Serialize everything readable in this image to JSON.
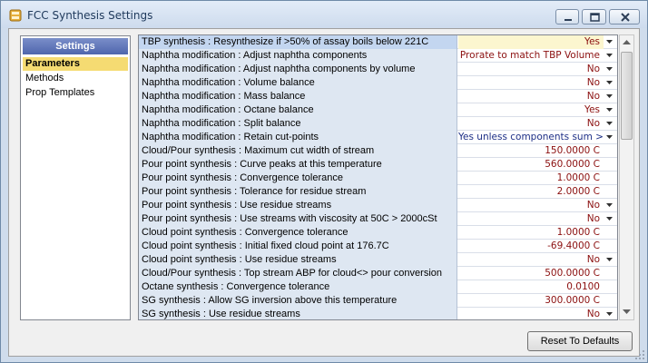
{
  "window": {
    "title": "FCC Synthesis Settings",
    "app_icon": "database-icon",
    "controls": {
      "minimize": "minimize-icon",
      "maximize": "maximize-icon",
      "close": "close-icon"
    }
  },
  "left_panel": {
    "header": "Settings",
    "items": [
      {
        "label": "Parameters",
        "selected": true
      },
      {
        "label": "Methods",
        "selected": false
      },
      {
        "label": "Prop Templates",
        "selected": false
      }
    ]
  },
  "rows": [
    {
      "label": "TBP synthesis : Resynthesize if >50% of assay boils below 221C",
      "value": "Yes",
      "dropdown": true
    },
    {
      "label": "Naphtha modification : Adjust naphtha components",
      "value": "Prorate to match TBP Volume",
      "dropdown": true
    },
    {
      "label": "Naphtha modification : Adjust naphtha components by volume",
      "value": "No",
      "dropdown": true
    },
    {
      "label": "Naphtha modification : Volume balance",
      "value": "No",
      "dropdown": true
    },
    {
      "label": "Naphtha modification : Mass balance",
      "value": "No",
      "dropdown": true
    },
    {
      "label": "Naphtha modification : Octane balance",
      "value": "Yes",
      "dropdown": true
    },
    {
      "label": "Naphtha modification : Split balance",
      "value": "No",
      "dropdown": true
    },
    {
      "label": "Naphtha modification : Retain cut-points",
      "value": "Yes unless components sum >",
      "dropdown": true,
      "color": "blue"
    },
    {
      "label": "Cloud/Pour synthesis : Maximum cut width of stream",
      "value": "150.0000 C",
      "dropdown": false
    },
    {
      "label": "Pour point synthesis : Curve peaks at this temperature",
      "value": "560.0000 C",
      "dropdown": false
    },
    {
      "label": "Pour point synthesis : Convergence tolerance",
      "value": "1.0000 C",
      "dropdown": false
    },
    {
      "label": "Pour point synthesis : Tolerance for residue stream",
      "value": "2.0000 C",
      "dropdown": false
    },
    {
      "label": "Pour point synthesis : Use residue streams",
      "value": "No",
      "dropdown": true
    },
    {
      "label": "Pour point synthesis : Use streams with viscosity at 50C > 2000cSt",
      "value": "No",
      "dropdown": true
    },
    {
      "label": "Cloud point synthesis : Convergence tolerance",
      "value": "1.0000 C",
      "dropdown": false
    },
    {
      "label": "Cloud point synthesis : Initial fixed cloud point at 176.7C",
      "value": "-69.4000 C",
      "dropdown": false
    },
    {
      "label": "Cloud point synthesis : Use residue streams",
      "value": "No",
      "dropdown": true
    },
    {
      "label": "Cloud/Pour synthesis : Top stream ABP for cloud<> pour conversion",
      "value": "500.0000 C",
      "dropdown": false
    },
    {
      "label": "Octane synthesis : Convergence tolerance",
      "value": "0.0100",
      "dropdown": false
    },
    {
      "label": "SG synthesis : Allow SG inversion above this temperature",
      "value": "300.0000 C",
      "dropdown": false
    },
    {
      "label": "SG synthesis : Use residue streams",
      "value": "No",
      "dropdown": true
    }
  ],
  "scrollbar": {
    "position_fraction": 0.0,
    "visible_fraction": 0.35
  },
  "reset_button": {
    "label": "Reset To Defaults"
  },
  "colors": {
    "value_text": "#8b0f0f",
    "value_text_blue": "#1d2f86",
    "label_bg": "#dee7f2",
    "selected_label_bg": "#c3d6f0",
    "selected_value_bg": "#fcf6cf",
    "nav_selected_bg": "#f5db72",
    "panel_header_bg": "#5c72b5"
  }
}
